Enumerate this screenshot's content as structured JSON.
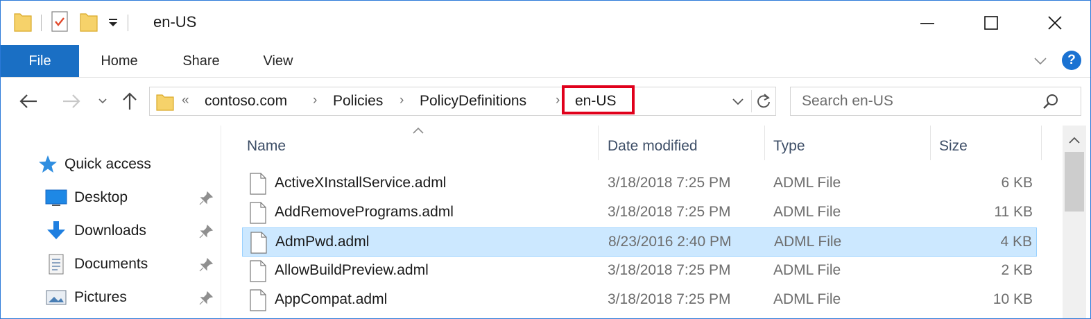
{
  "window": {
    "title": "en-US"
  },
  "titlebar_buttons": {
    "minimize_icon": "minimize-icon",
    "maximize_icon": "maximize-icon",
    "close_icon": "close-icon"
  },
  "ribbon": {
    "tabs": [
      {
        "label": "File",
        "active": true
      },
      {
        "label": "Home"
      },
      {
        "label": "Share"
      },
      {
        "label": "View"
      }
    ],
    "accent_color": "#1a6fc4",
    "help_label": "?"
  },
  "navigation": {
    "recent_marker": "«",
    "breadcrumb": [
      "contoso.com",
      "Policies",
      "PolicyDefinitions",
      "en-US"
    ],
    "highlighted_segment": "en-US",
    "highlight_color": "#e0001b"
  },
  "search": {
    "placeholder": "Search en-US"
  },
  "sidebar": {
    "quick_access_label": "Quick access",
    "items": [
      {
        "label": "Desktop",
        "icon": "desktop-icon",
        "pinned": true
      },
      {
        "label": "Downloads",
        "icon": "downloads-icon",
        "pinned": true
      },
      {
        "label": "Documents",
        "icon": "documents-icon",
        "pinned": true
      },
      {
        "label": "Pictures",
        "icon": "pictures-icon",
        "pinned": true
      }
    ]
  },
  "file_list": {
    "columns": {
      "name": "Name",
      "date": "Date modified",
      "type": "Type",
      "size": "Size"
    },
    "sort_column": "Name",
    "rows": [
      {
        "name": "ActiveXInstallService.adml",
        "date": "3/18/2018 7:25 PM",
        "type": "ADML File",
        "size": "6 KB"
      },
      {
        "name": "AddRemovePrograms.adml",
        "date": "3/18/2018 7:25 PM",
        "type": "ADML File",
        "size": "11 KB"
      },
      {
        "name": "AdmPwd.adml",
        "date": "8/23/2016 2:40 PM",
        "type": "ADML File",
        "size": "4 KB",
        "selected": true
      },
      {
        "name": "AllowBuildPreview.adml",
        "date": "3/18/2018 7:25 PM",
        "type": "ADML File",
        "size": "2 KB"
      },
      {
        "name": "AppCompat.adml",
        "date": "3/18/2018 7:25 PM",
        "type": "ADML File",
        "size": "10 KB"
      }
    ],
    "selection_color": "#cce8ff"
  }
}
